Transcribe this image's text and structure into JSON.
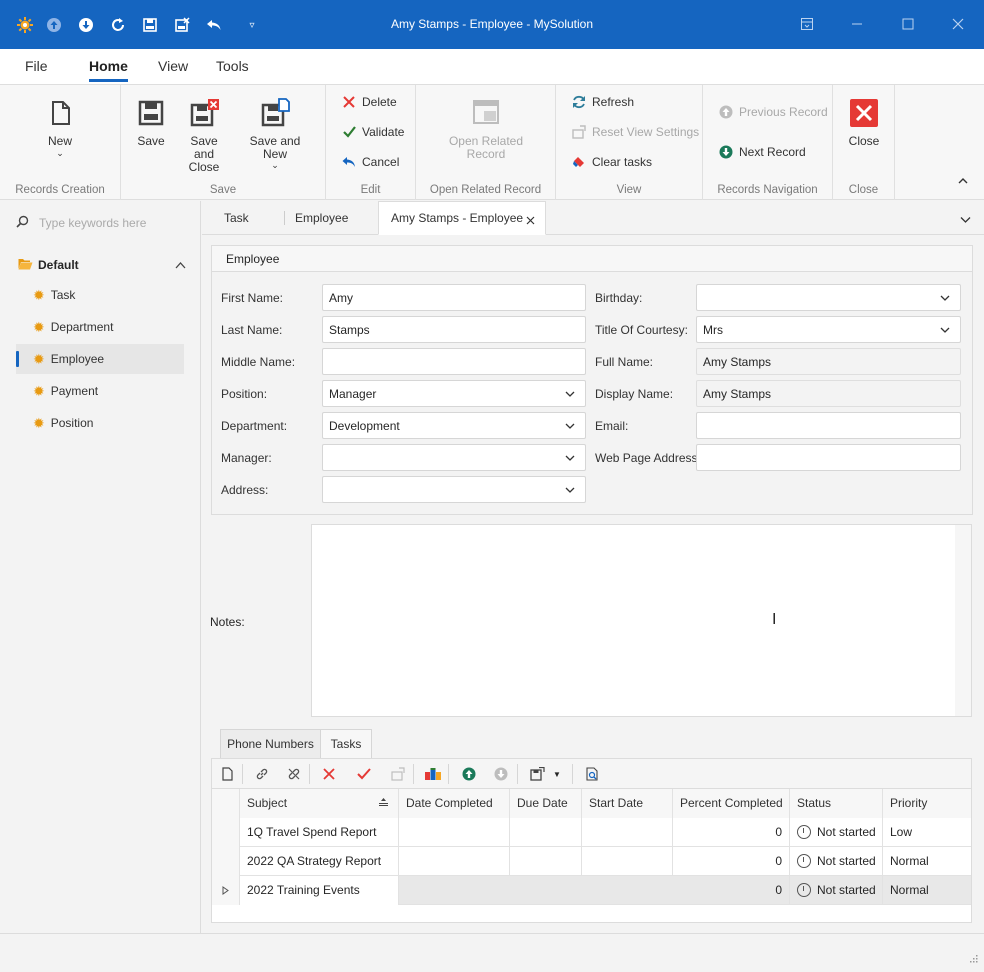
{
  "window": {
    "title": "Amy Stamps - Employee - MySolution"
  },
  "ribbon_tabs": [
    "File",
    "Home",
    "View",
    "Tools"
  ],
  "ribbon": {
    "groups": {
      "records_creation": "Records Creation",
      "save": "Save",
      "edit": "Edit",
      "open_related": "Open Related Record",
      "view": "View",
      "navigation": "Records Navigation",
      "close": "Close"
    },
    "new_label": "New",
    "save_label": "Save",
    "save_close_label": "Save and Close",
    "save_new_label": "Save and New",
    "delete_label": "Delete",
    "validate_label": "Validate",
    "cancel_label": "Cancel",
    "open_related_label": "Open Related Record",
    "refresh_label": "Refresh",
    "reset_view_label": "Reset View Settings",
    "clear_tasks_label": "Clear tasks",
    "prev_record_label": "Previous Record",
    "next_record_label": "Next Record",
    "close_label": "Close"
  },
  "sidebar": {
    "search_placeholder": "Type keywords here",
    "group": "Default",
    "items": [
      "Task",
      "Department",
      "Employee",
      "Payment",
      "Position"
    ],
    "selected": "Employee"
  },
  "doc_tabs": [
    "Task",
    "Employee",
    "Amy Stamps - Employee"
  ],
  "employee": {
    "group_title": "Employee",
    "labels": {
      "first_name": "First Name:",
      "last_name": "Last Name:",
      "middle_name": "Middle Name:",
      "position": "Position:",
      "department": "Department:",
      "manager": "Manager:",
      "address": "Address:",
      "birthday": "Birthday:",
      "title_of_courtesy": "Title Of Courtesy:",
      "full_name": "Full Name:",
      "display_name": "Display Name:",
      "email": "Email:",
      "web_page": "Web Page Address:",
      "notes": "Notes:"
    },
    "values": {
      "first_name": "Amy",
      "last_name": "Stamps",
      "middle_name": "",
      "position": "Manager",
      "department": "Development",
      "manager": "",
      "address": "",
      "birthday": "",
      "title_of_courtesy": "Mrs",
      "full_name": "Amy Stamps",
      "display_name": "Amy Stamps",
      "email": "",
      "web_page": ""
    }
  },
  "detail_tabs": [
    "Phone Numbers",
    "Tasks"
  ],
  "tasks": {
    "columns": [
      "Subject",
      "Date Completed",
      "Due Date",
      "Start Date",
      "Percent Completed",
      "Status",
      "Priority"
    ],
    "rows": [
      {
        "subject": "1Q Travel Spend Report",
        "date_completed": "",
        "due_date": "",
        "start_date": "",
        "percent": "0",
        "status": "Not started",
        "priority": "Low"
      },
      {
        "subject": "2022 QA Strategy Report",
        "date_completed": "",
        "due_date": "",
        "start_date": "",
        "percent": "0",
        "status": "Not started",
        "priority": "Normal"
      },
      {
        "subject": "2022 Training Events",
        "date_completed": "",
        "due_date": "",
        "start_date": "",
        "percent": "0",
        "status": "Not started",
        "priority": "Normal"
      }
    ]
  },
  "colors": {
    "accent": "#1565c0",
    "gear": "#e89a12",
    "delete_red": "#e53935",
    "validate_green": "#2e7d32"
  }
}
